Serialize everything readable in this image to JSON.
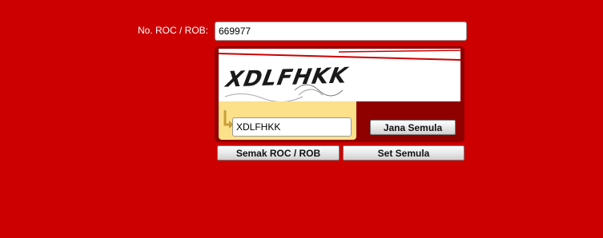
{
  "form": {
    "roc_label": "No. ROC / ROB:",
    "roc_value": "669977"
  },
  "captcha": {
    "code": "XDLFHKK",
    "answer_value": "XDLFHKK",
    "regenerate_label": "Jana Semula"
  },
  "actions": {
    "check_label": "Semak ROC / ROB",
    "reset_label": "Set Semula"
  },
  "colors": {
    "background": "#cc0000",
    "panel": "#8f0000",
    "answer_area": "#fde08a"
  },
  "icons": {
    "answer_pointer": "arrow-icon"
  }
}
